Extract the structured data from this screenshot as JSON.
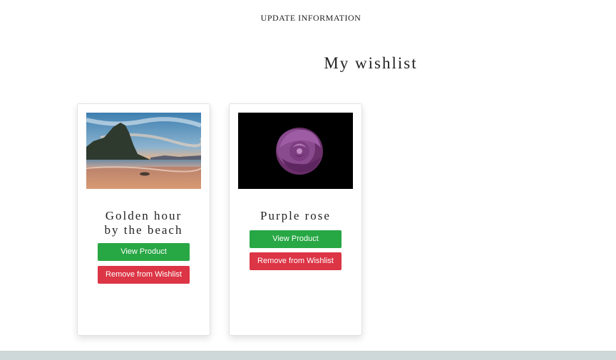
{
  "header": {
    "update_link": "UPDATE INFORMATION"
  },
  "wishlist": {
    "title": "My wishlist",
    "items": [
      {
        "name_line1": "Golden hour",
        "name_line2": "by the beach",
        "image": "beach-sunset-image",
        "view_label": "View Product",
        "remove_label": "Remove from Wishlist"
      },
      {
        "name_line1": "Purple rose",
        "name_line2": "",
        "image": "purple-rose-image",
        "view_label": "View Product",
        "remove_label": "Remove from Wishlist"
      }
    ]
  },
  "colors": {
    "view_button": "#28a745",
    "remove_button": "#dc3545",
    "footer": "#cfd8d8"
  }
}
